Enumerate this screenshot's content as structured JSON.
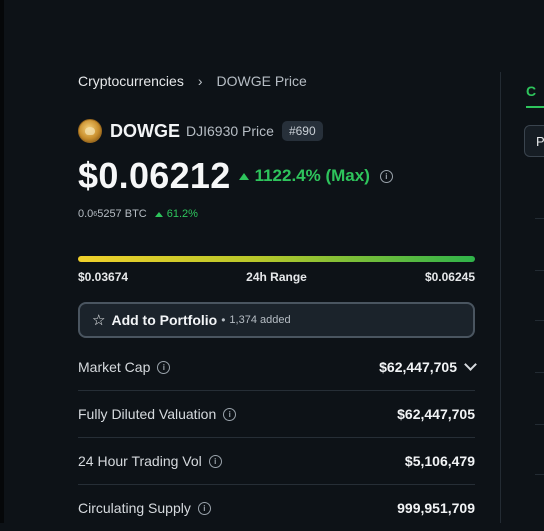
{
  "breadcrumb": {
    "root": "Cryptocurrencies",
    "separator": "›",
    "current": "DOWGE Price"
  },
  "coin": {
    "name": "DOWGE",
    "pair_label": "DJI6930 Price",
    "rank": "#690",
    "logo_icon": "dowge-logo-icon"
  },
  "price": {
    "value": "$0.06212",
    "change_pct": "1122.4% (Max)",
    "change_color": "#2ec45c"
  },
  "btc": {
    "prefix": "0.0",
    "zero_count": "6",
    "rest": "5257 BTC",
    "change_pct": "61.2%"
  },
  "range": {
    "low": "$0.03674",
    "label": "24h Range",
    "high": "$0.06245",
    "position_pct": 98.7
  },
  "portfolio": {
    "label": "Add to Portfolio",
    "dot": "•",
    "count": "1,374 added",
    "icon": "star-icon"
  },
  "stats": [
    {
      "label": "Market Cap",
      "value": "$62,447,705"
    },
    {
      "label": "Fully Diluted Valuation",
      "value": "$62,447,705"
    },
    {
      "label": "24 Hour Trading Vol",
      "value": "$5,106,479"
    },
    {
      "label": "Circulating Supply",
      "value": "999,951,709"
    }
  ],
  "right_panel": {
    "tab_label": "C",
    "dropdown_label": "P"
  },
  "colors": {
    "background": "#0d1217",
    "accent_green": "#2ec45c",
    "border": "#4a5560"
  }
}
